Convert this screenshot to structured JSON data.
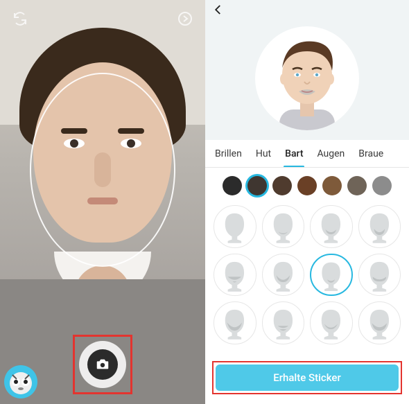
{
  "left": {
    "switch_icon": "switch-camera-icon",
    "confirm_icon": "confirm-icon",
    "mascot_icon": "mascot-icon",
    "shutter_icon": "camera-icon"
  },
  "right": {
    "back_icon": "back-icon",
    "tabs": [
      {
        "label": "Brillen",
        "active": false
      },
      {
        "label": "Hut",
        "active": false
      },
      {
        "label": "Bart",
        "active": true
      },
      {
        "label": "Augen",
        "active": false
      },
      {
        "label": "Braue",
        "active": false
      }
    ],
    "colors": [
      {
        "hex": "#2b2b2b",
        "selected": false
      },
      {
        "hex": "#3f3630",
        "selected": true
      },
      {
        "hex": "#4f3b2e",
        "selected": false
      },
      {
        "hex": "#6a4026",
        "selected": false
      },
      {
        "hex": "#7e5a3a",
        "selected": false
      },
      {
        "hex": "#6f6458",
        "selected": false
      },
      {
        "hex": "#8c8c8c",
        "selected": false
      }
    ],
    "styles_selected_index": 6,
    "styles_count": 12,
    "cta_label": "Erhalte Sticker"
  }
}
